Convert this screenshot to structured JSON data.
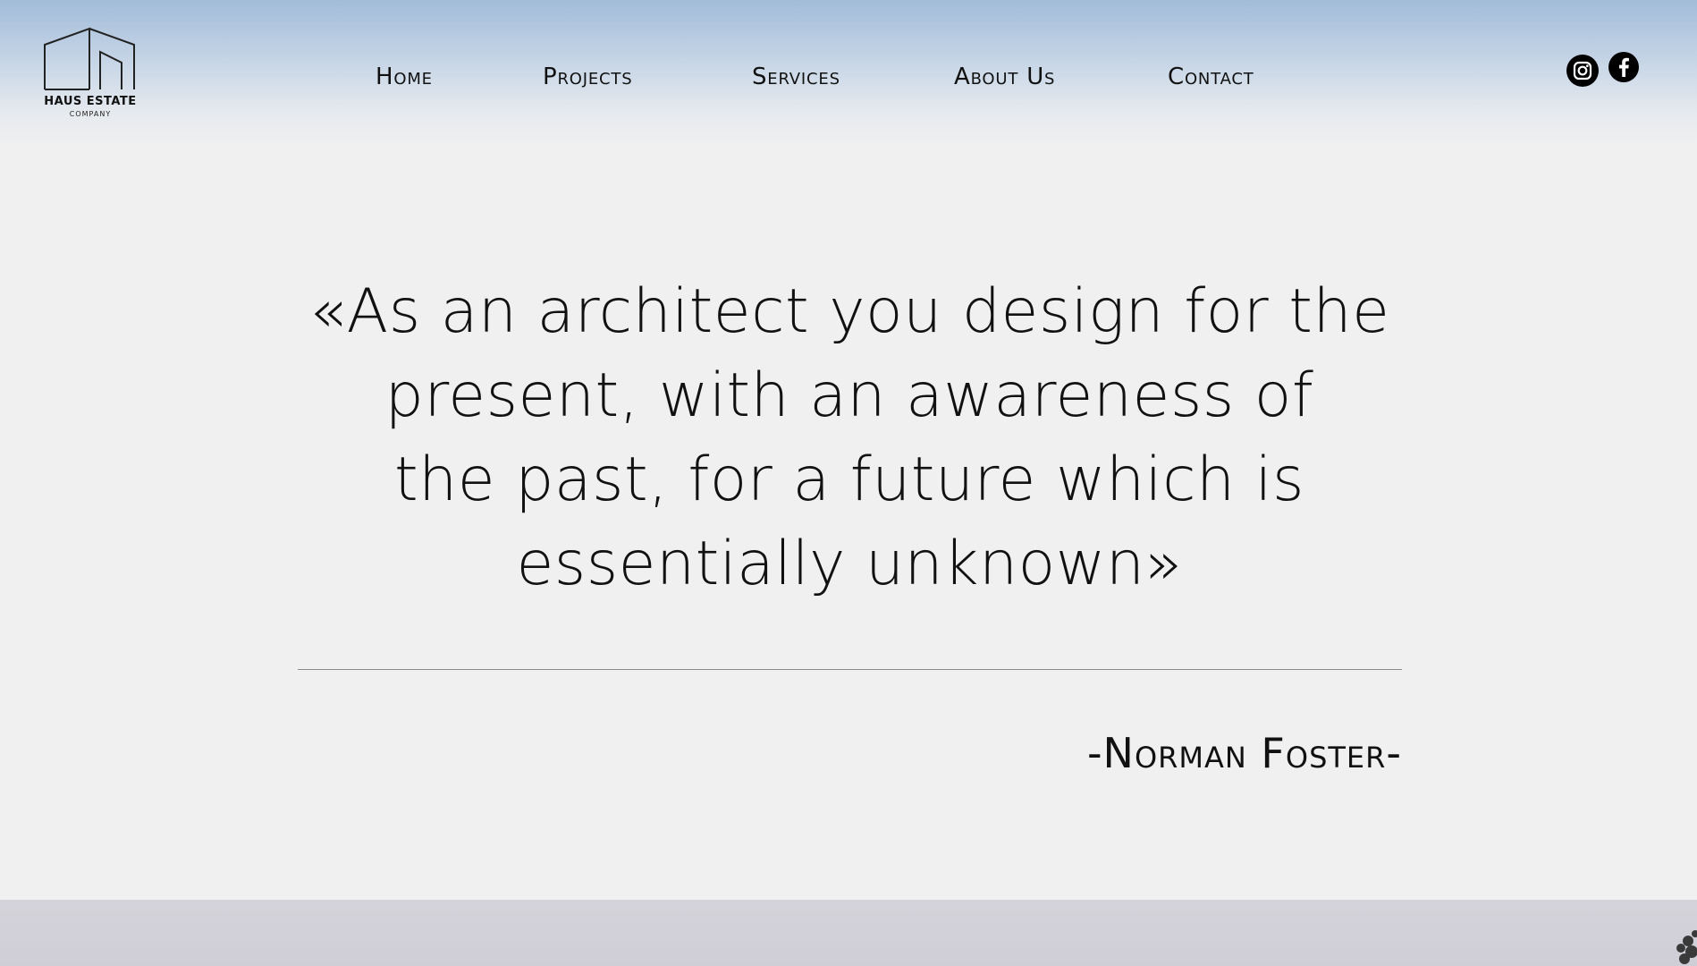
{
  "header": {
    "logo": {
      "name": "HAUS ESTATE",
      "subtitle": "COMPANY",
      "icon": "house-outline-icon"
    },
    "nav": [
      {
        "label": "Home"
      },
      {
        "label": "Projects"
      },
      {
        "label": "Services"
      },
      {
        "label": "About Us"
      },
      {
        "label": "Contact"
      }
    ],
    "social": [
      {
        "name": "instagram",
        "icon": "instagram-icon"
      },
      {
        "name": "facebook",
        "icon": "facebook-icon"
      }
    ]
  },
  "quote": {
    "lines": [
      "«As an architect you design for the",
      "present, with an awareness of",
      "the past, for a future which is",
      "essentially unknown»"
    ],
    "attribution": "-Norman Foster-"
  },
  "colors": {
    "header_top": "#a2bcd9",
    "background": "#f0f0f0",
    "text": "#111111",
    "divider": "#8c8c8c",
    "bottom_strip": "#d5d3da"
  }
}
